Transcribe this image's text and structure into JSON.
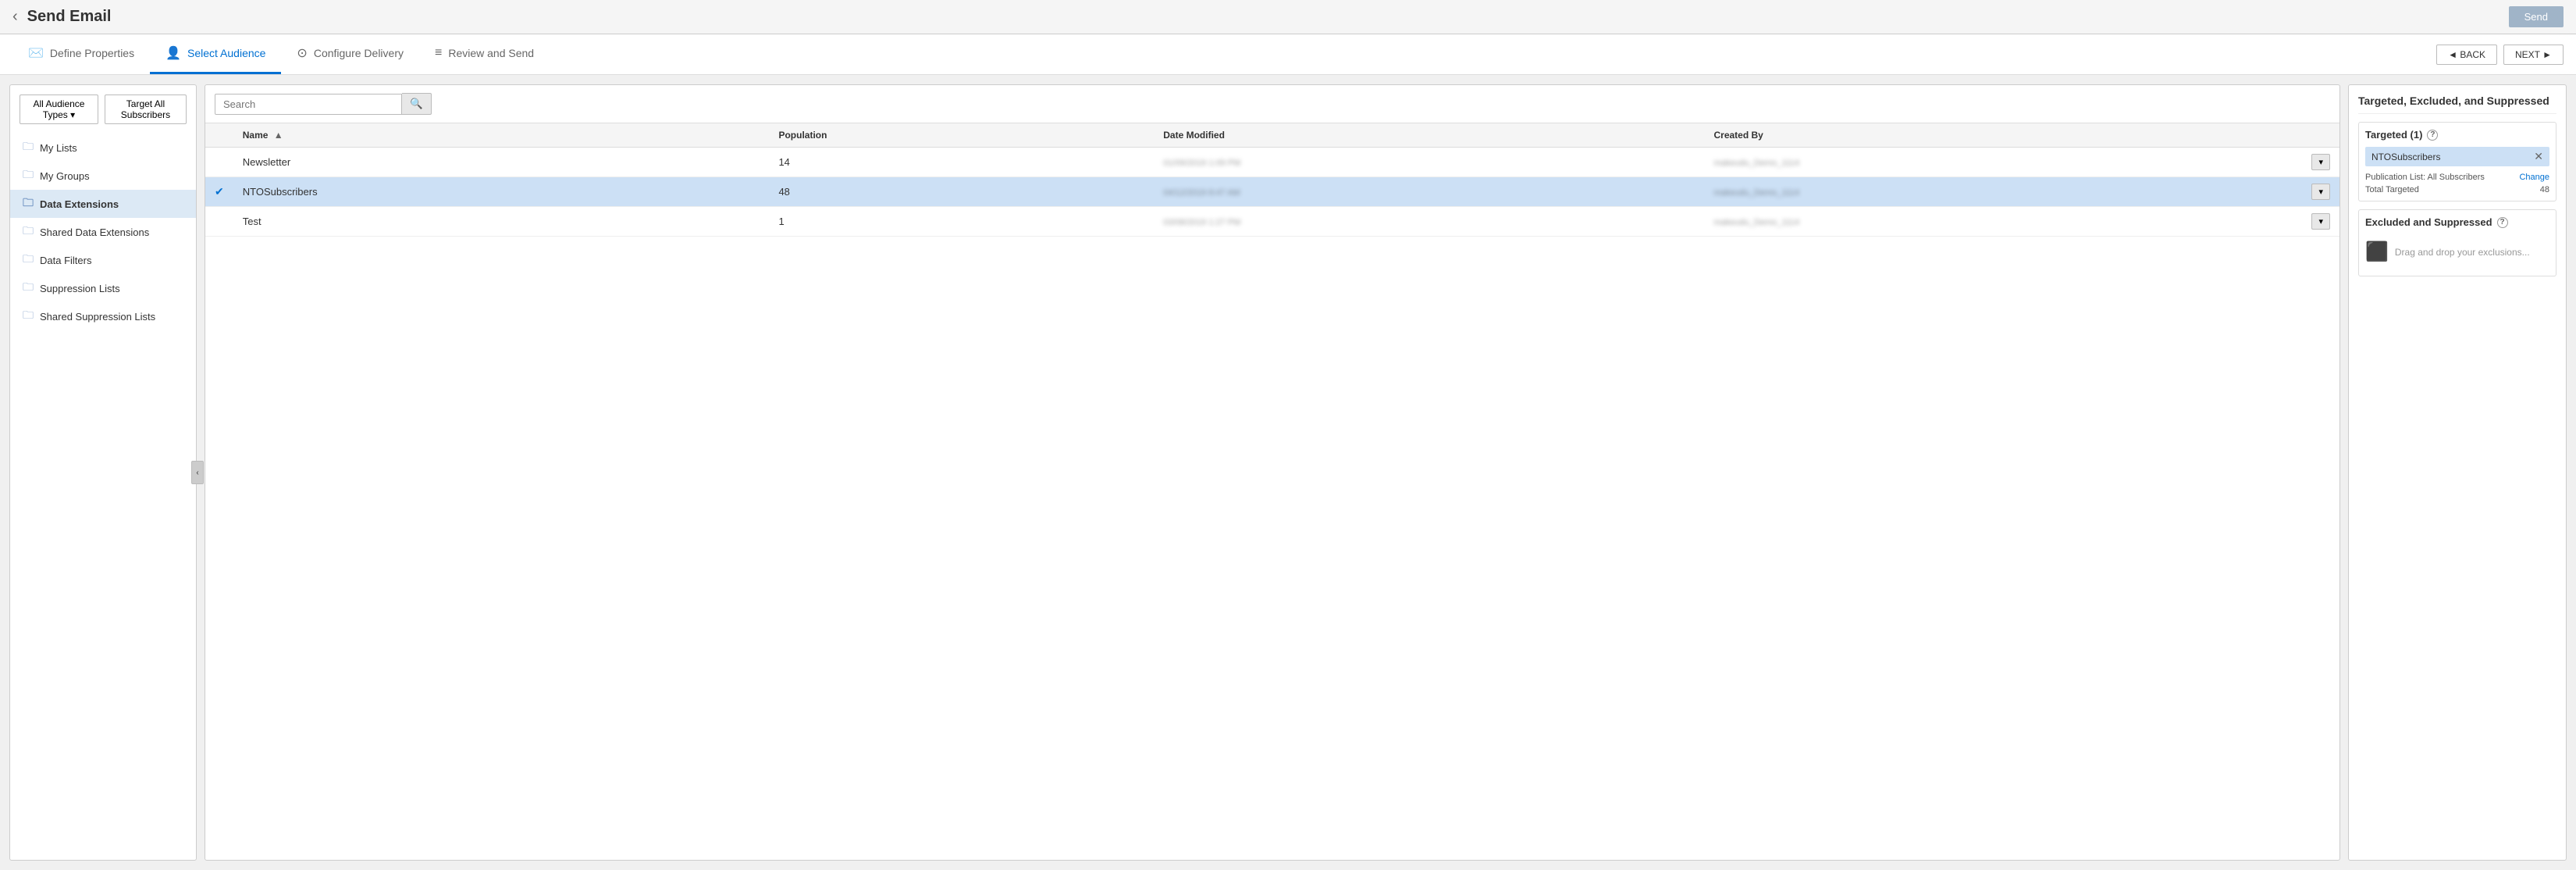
{
  "header": {
    "title": "Send Email",
    "send_label": "Send",
    "back_arrow": "‹"
  },
  "wizard": {
    "tabs": [
      {
        "id": "define",
        "label": "Define Properties",
        "icon": "✉",
        "active": false,
        "checkmark": true
      },
      {
        "id": "audience",
        "label": "Select Audience",
        "icon": "👤",
        "active": true
      },
      {
        "id": "delivery",
        "label": "Configure Delivery",
        "icon": "⊙",
        "active": false
      },
      {
        "id": "review",
        "label": "Review and Send",
        "icon": "≡",
        "active": false
      }
    ],
    "back_label": "◄ BACK",
    "next_label": "NEXT ►"
  },
  "sidebar": {
    "audience_dropdown_label": "All Audience Types ▾",
    "target_all_label": "Target All Subscribers",
    "nav_items": [
      {
        "id": "my-lists",
        "label": "My Lists",
        "selected": false
      },
      {
        "id": "my-groups",
        "label": "My Groups",
        "selected": false
      },
      {
        "id": "data-extensions",
        "label": "Data Extensions",
        "selected": true
      },
      {
        "id": "shared-data-extensions",
        "label": "Shared Data Extensions",
        "selected": false
      },
      {
        "id": "data-filters",
        "label": "Data Filters",
        "selected": false
      },
      {
        "id": "suppression-lists",
        "label": "Suppression Lists",
        "selected": false
      },
      {
        "id": "shared-suppression-lists",
        "label": "Shared Suppression Lists",
        "selected": false
      }
    ]
  },
  "table": {
    "search_placeholder": "Search",
    "search_icon": "🔍",
    "columns": [
      {
        "id": "name",
        "label": "Name",
        "sortable": true,
        "sort_dir": "asc"
      },
      {
        "id": "population",
        "label": "Population",
        "sortable": false
      },
      {
        "id": "date_modified",
        "label": "Date Modified",
        "sortable": false
      },
      {
        "id": "created_by",
        "label": "Created By",
        "sortable": false
      }
    ],
    "rows": [
      {
        "id": 1,
        "selected": false,
        "name": "Newsletter",
        "population": "14",
        "date_modified": "01/09/2019 1:09 PM",
        "created_by": "makeudu_Demo_1114"
      },
      {
        "id": 2,
        "selected": true,
        "name": "NTOSubscribers",
        "population": "48",
        "date_modified": "04/12/2019 8:47 AM",
        "created_by": "makeudu_Demo_1114"
      },
      {
        "id": 3,
        "selected": false,
        "name": "Test",
        "population": "1",
        "date_modified": "03/08/2019 1:27 PM",
        "created_by": "makeudu_Demo_1114"
      }
    ]
  },
  "right_panel": {
    "title": "Targeted, Excluded, and Suppressed",
    "targeted_header": "Targeted (1)",
    "targeted_item": "NTOSubscribers",
    "publication_list_label": "Publication List:  All Subscribers",
    "change_label": "Change",
    "total_targeted_label": "Total Targeted",
    "total_targeted_value": "48",
    "excluded_header": "Excluded and Suppressed",
    "drag_hint": "Drag and drop your exclusions...",
    "help_icon": "?"
  }
}
